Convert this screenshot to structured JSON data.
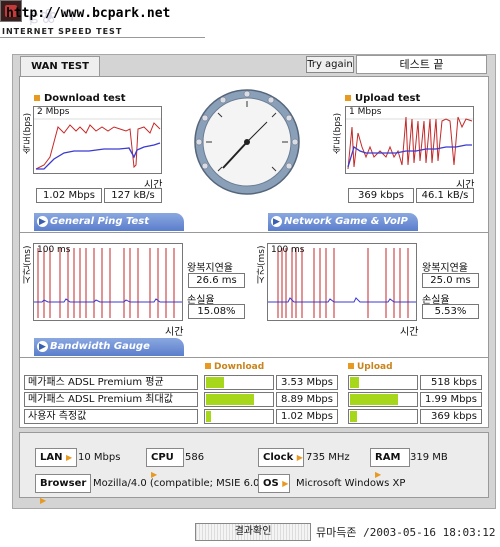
{
  "header": {
    "url": "http://www.bcpark.net",
    "title": "INTERNET SPEED TEST"
  },
  "tabs": {
    "wan": "WAN TEST"
  },
  "controls": {
    "try_again": "Try again",
    "status": "테스트 끝"
  },
  "download": {
    "title": "Download test",
    "y_label": "속도(bps)",
    "scale": "2 Mbps",
    "x_label": "시간",
    "value_bps": "1.02 Mbps",
    "value_bytes": "127 kB/s"
  },
  "upload": {
    "title": "Upload test",
    "y_label": "속도(bps)",
    "scale": "1 Mbps",
    "x_label": "시간",
    "value_bps": "369 kbps",
    "value_bytes": "46.1 kB/s"
  },
  "banners": {
    "ping": "General Ping Test",
    "game": "Network Game & VoIP Test",
    "bandwidth": "Bandwidth Gauge"
  },
  "ping": {
    "y_label": "시간(ms)",
    "scale": "100 ms",
    "x_label": "시간",
    "rtt_label": "왕복지연율",
    "rtt_value": "26.6 ms",
    "loss_label": "손실율",
    "loss_value": "15.08%"
  },
  "game": {
    "y_label": "시간(ms)",
    "scale": "100 ms",
    "x_label": "시간",
    "rtt_label": "왕복지연율",
    "rtt_value": "25.0 ms",
    "loss_label": "손실율",
    "loss_value": "5.53%"
  },
  "bandwidth": {
    "download_header": "Download",
    "upload_header": "Upload",
    "rows": [
      {
        "label": "메가패스 ADSL Premium 평균",
        "down": "3.53 Mbps",
        "down_pct": 0.28,
        "up": "518 kbps",
        "up_pct": 0.14
      },
      {
        "label": "메가패스 ADSL Premium 최대값",
        "down": "8.89 Mbps",
        "down_pct": 0.72,
        "up": "1.99 Mbps",
        "up_pct": 0.72
      },
      {
        "label": "사용자 측정값",
        "down": "1.02 Mbps",
        "down_pct": 0.08,
        "up": "369 kbps",
        "up_pct": 0.1
      }
    ]
  },
  "system": {
    "lan_label": "LAN",
    "lan": "10 Mbps",
    "cpu_label": "CPU",
    "cpu": "586",
    "clock_label": "Clock",
    "clock": "735 MHz",
    "ram_label": "RAM",
    "ram": "319 MB",
    "browser_label": "Browser",
    "browser": "Mozilla/4.0 (compatible; MSIE 6.0",
    "os_label": "OS",
    "os": "Microsoft Windows XP"
  },
  "footer": {
    "confirm": "결과확인",
    "stamp": "뮤마득존 /2003-05-16 18:03:12"
  },
  "colors": {
    "accent": "#e89920",
    "banner": "#5b7ecc",
    "download_line": "#c62828",
    "upload_line": "#3a3ad0",
    "gauge": "#a6d71a"
  }
}
